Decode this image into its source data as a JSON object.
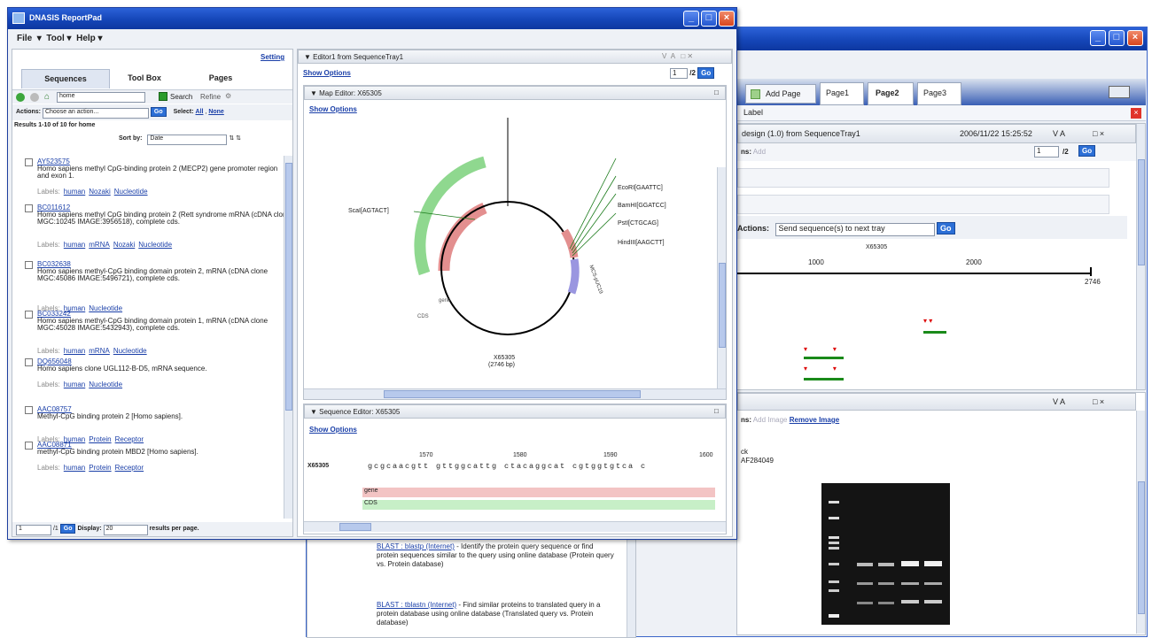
{
  "main_window": {
    "title": "DNASIS ReportPad",
    "menu": [
      "File",
      "Tool",
      "Help"
    ],
    "setting": "Setting",
    "tabs": [
      "Sequences",
      "Tool Box",
      "Pages"
    ],
    "search": {
      "value": "home",
      "search_label": "Search",
      "refine_label": "Refine"
    },
    "actions": {
      "label": "Actions:",
      "select_value": "Choose an action...",
      "go": "Go",
      "select_label": "Select:",
      "all": "All",
      "none": "None"
    },
    "results_text": "Results 1-10 of 10 for home",
    "sortby_label": "Sort by:",
    "sortby_value": "Date",
    "labels_prefix": "Labels:",
    "items": [
      {
        "acc": "AY523575",
        "desc": "Homo sapiens methyl CpG-binding protein 2 (MECP2) gene promoter region and exon 1.",
        "labels": [
          "human",
          "Nozaki",
          "Nucleotide"
        ]
      },
      {
        "acc": "BC011612",
        "desc": "Homo sapiens methyl CpG binding protein 2 (Rett syndrome mRNA (cDNA clone MGC:10245 IMAGE:3956518), complete cds.",
        "labels": [
          "human",
          "mRNA",
          "Nozaki",
          "Nucleotide"
        ]
      },
      {
        "acc": "BC032638",
        "desc": "Homo sapiens methyl-CpG binding domain protein 2, mRNA (cDNA clone MGC:45086 IMAGE:5496721), complete cds.",
        "labels": [
          "human",
          "Nucleotide"
        ]
      },
      {
        "acc": "BC033242",
        "desc": "Homo sapiens methyl-CpG binding domain protein 1, mRNA (cDNA clone MGC:45028 IMAGE:5432943), complete cds.",
        "labels": [
          "human",
          "mRNA",
          "Nucleotide"
        ]
      },
      {
        "acc": "DQ656048",
        "desc": "Homo sapiens clone UGL112-B-D5, mRNA sequence.",
        "labels": [
          "human",
          "Nucleotide"
        ]
      },
      {
        "acc": "AAC08757",
        "desc": "Methyl-CpG binding protein 2 [Homo sapiens].",
        "labels": [
          "human",
          "Protein",
          "Receptor"
        ]
      },
      {
        "acc": "AAC08871",
        "desc": "methyl-CpG binding protein MBD2 [Homo sapiens].",
        "labels": [
          "human",
          "Protein",
          "Receptor"
        ]
      }
    ],
    "pager": {
      "page": "1",
      "of": "/1",
      "go": "Go",
      "display_label": "Display:",
      "display_value": "20",
      "per_page": "results per page."
    }
  },
  "editor": {
    "title": "Editor1 from SequenceTray1",
    "show_options": "Show Options",
    "page": "1",
    "of": "/2",
    "go": "Go",
    "map_editor": {
      "title": "Map Editor: X65305",
      "show_options": "Show Options",
      "seq_name": "X65305",
      "seq_len": "(2746 bp)",
      "sites": [
        "EcoRI[GAATTC]",
        "BamHI[GGATCC]",
        "PstI[CTGCAG]",
        "HindIII[AAGCTT]"
      ],
      "left_site": "ScaI[AGTACT]",
      "arc_label": "gene",
      "arc_label2": "CDS",
      "small_label": "MCS-pUC19"
    },
    "seq_editor": {
      "title": "Sequence Editor: X65305",
      "show_options": "Show Options",
      "ruler": [
        "1570",
        "1580",
        "1590",
        "1600"
      ],
      "seq_id": "X65305",
      "sequence": "gcgcaacgtt gttggcattg ctacaggcat cgtggtgtca c",
      "tracks": [
        "gene",
        "CDS"
      ]
    }
  },
  "back_window": {
    "tabs": [
      "Add Page",
      "Page1",
      "Page2",
      "Page3"
    ],
    "label_btn": "Label",
    "design": {
      "title": "design (1.0) from SequenceTray1",
      "date": "2006/11/22 15:25:52",
      "ctrl": "V  A",
      "page": "1",
      "of": "/2",
      "go": "Go",
      "add": "Add",
      "actions_label": "Actions:",
      "actions_value": "Send sequence(s) to next tray",
      "seq": "X65305",
      "ticks": [
        "1000",
        "2000"
      ],
      "end": "2746"
    },
    "image_panel": {
      "ctrl": "V  A",
      "add_image": "Add Image",
      "remove_image": "Remove Image",
      "label_text": "ck",
      "acc": "AF284049"
    },
    "toolbox": [
      {
        "link": "BLAST : blastp (Internet)",
        "text": "- Identify the protein query sequence or find protein sequences similar to the query using online database (Protein query vs. Protein database)"
      },
      {
        "link": "BLAST : tblastn (Internet)",
        "text": "- Find similar proteins to translated query in a protein database using online database (Translated query vs. Protein database)"
      }
    ]
  },
  "colors": {
    "title_blue": "#1546b8",
    "gene_red": "#e38f8f",
    "cds_green": "#8fd88f",
    "site_purple": "#9a96e0"
  }
}
